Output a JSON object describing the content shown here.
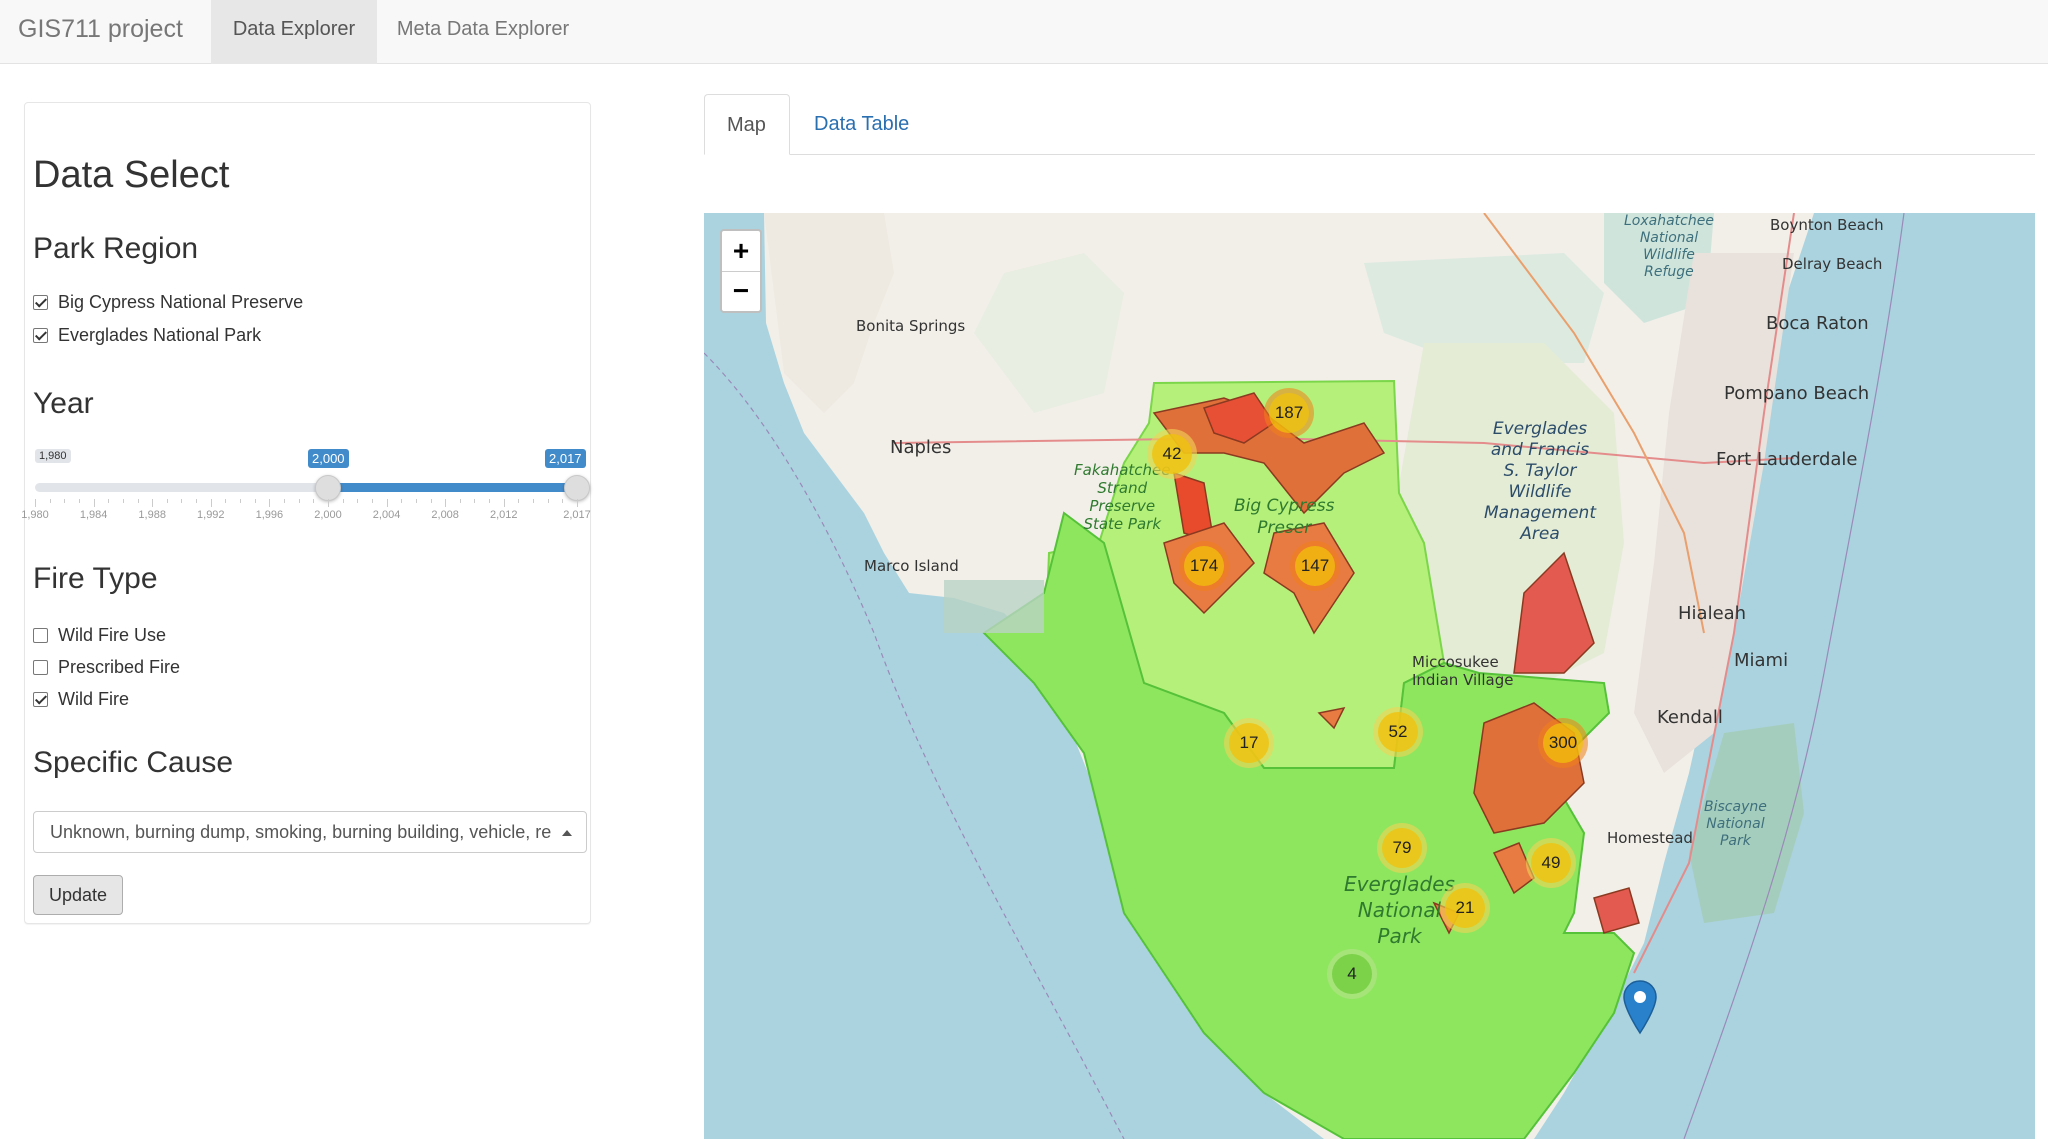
{
  "navbar": {
    "brand": "GIS711 project",
    "tabs": [
      {
        "label": "Data Explorer",
        "active": true
      },
      {
        "label": "Meta Data Explorer",
        "active": false
      }
    ]
  },
  "sidebar": {
    "title": "Data Select",
    "park_region": {
      "heading": "Park Region",
      "options": [
        {
          "label": "Big Cypress National Preserve",
          "checked": true
        },
        {
          "label": "Everglades National Park",
          "checked": true
        }
      ]
    },
    "year": {
      "heading": "Year",
      "min_label": "1,980",
      "from_label": "2,000",
      "to_label": "2,017",
      "min": 1980,
      "max": 2017,
      "from": 2000,
      "to": 2017,
      "tick_labels": [
        "1,980",
        "1,984",
        "1,988",
        "1,992",
        "1,996",
        "2,000",
        "2,004",
        "2,008",
        "2,012",
        "2,017"
      ]
    },
    "fire_type": {
      "heading": "Fire Type",
      "options": [
        {
          "label": "Wild Fire Use",
          "checked": false
        },
        {
          "label": "Prescribed Fire",
          "checked": false
        },
        {
          "label": "Wild Fire",
          "checked": true
        }
      ]
    },
    "specific_cause": {
      "heading": "Specific Cause",
      "selected": "Unknown, burning dump, smoking, burning building, vehicle, re"
    },
    "update_label": "Update"
  },
  "tabs": [
    {
      "label": "Map",
      "active": true
    },
    {
      "label": "Data Table",
      "active": false
    }
  ],
  "map": {
    "zoom_in": "+",
    "zoom_out": "−",
    "clusters": [
      "187",
      "42",
      "174",
      "147",
      "17",
      "52",
      "300",
      "79",
      "49",
      "21",
      "4"
    ],
    "places": {
      "bonita_springs": "Bonita Springs",
      "naples": "Naples",
      "marco_island": "Marco Island",
      "boynton_beach": "Boynton Beach",
      "delray_beach": "Delray Beach",
      "boca_raton": "Boca Raton",
      "pompano_beach": "Pompano Beach",
      "fort_lauderdale": "Fort Lauderdale",
      "hialeah": "Hialeah",
      "miami": "Miami",
      "kendall": "Kendall",
      "homestead": "Homestead",
      "miccosukee_1": "Miccosukee",
      "miccosukee_2": "Indian Village",
      "fakahatchee": [
        "Fakahatchee",
        "Strand",
        "Preserve",
        "State Park"
      ],
      "big_cypress": [
        "Big Cypress",
        "Preser"
      ],
      "everglades_wma": [
        "Everglades",
        "and Francis",
        "S. Taylor",
        "Wildlife",
        "Management",
        "Area"
      ],
      "loxahatchee": [
        "Loxahatchee",
        "National",
        "Wildlife",
        "Refuge"
      ],
      "biscayne": [
        "Biscayne",
        "National",
        "Park"
      ],
      "everglades_np": [
        "Everglades",
        "National",
        "Park"
      ]
    }
  }
}
